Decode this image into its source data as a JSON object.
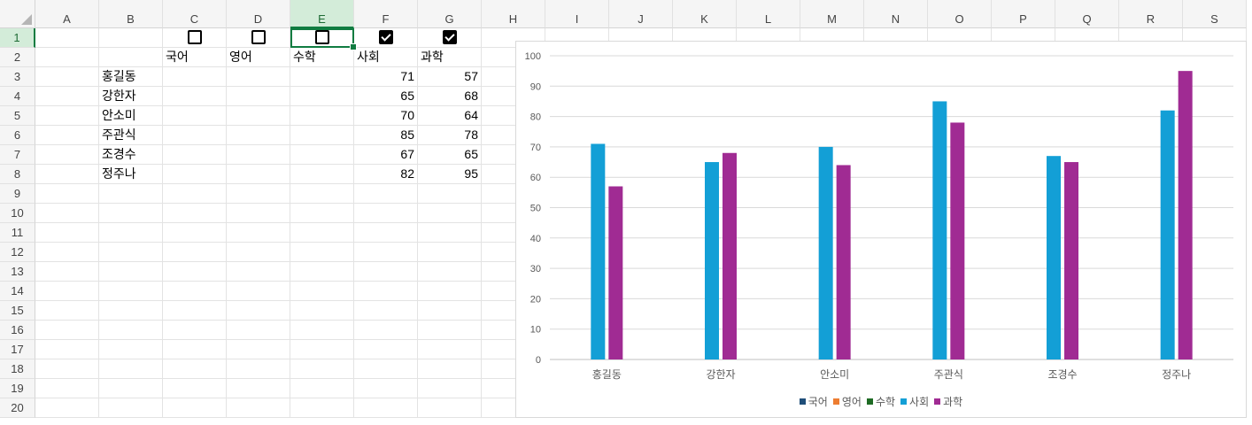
{
  "spreadsheet": {
    "columns": [
      "A",
      "B",
      "C",
      "D",
      "E",
      "F",
      "G",
      "H",
      "I",
      "J",
      "K",
      "L",
      "M",
      "N",
      "O",
      "P",
      "Q",
      "R",
      "S"
    ],
    "rows": [
      "1",
      "2",
      "3",
      "4",
      "5",
      "6",
      "7",
      "8",
      "9",
      "10",
      "11",
      "12",
      "13",
      "14",
      "15",
      "16",
      "17",
      "18",
      "19",
      "20"
    ],
    "selected_column": "E",
    "selected_row": "1",
    "checkboxes": [
      {
        "col": "C",
        "checked": false
      },
      {
        "col": "D",
        "checked": false
      },
      {
        "col": "E",
        "checked": false
      },
      {
        "col": "F",
        "checked": true
      },
      {
        "col": "G",
        "checked": true
      }
    ],
    "headers": [
      "국어",
      "영어",
      "수학",
      "사회",
      "과학"
    ],
    "students": [
      {
        "name": "홍길동",
        "social": "71",
        "science": "57"
      },
      {
        "name": "강한자",
        "social": "65",
        "science": "68"
      },
      {
        "name": "안소미",
        "social": "70",
        "science": "64"
      },
      {
        "name": "주관식",
        "social": "85",
        "science": "78"
      },
      {
        "name": "조경수",
        "social": "67",
        "science": "65"
      },
      {
        "name": "정주나",
        "social": "82",
        "science": "95"
      }
    ]
  },
  "chart_data": {
    "type": "bar",
    "categories": [
      "홍길동",
      "강한자",
      "안소미",
      "주관식",
      "조경수",
      "정주나"
    ],
    "series": [
      {
        "name": "국어",
        "values": [
          null,
          null,
          null,
          null,
          null,
          null
        ],
        "color": "#1f4e79"
      },
      {
        "name": "영어",
        "values": [
          null,
          null,
          null,
          null,
          null,
          null
        ],
        "color": "#ed7d31"
      },
      {
        "name": "수학",
        "values": [
          null,
          null,
          null,
          null,
          null,
          null
        ],
        "color": "#1e6b24"
      },
      {
        "name": "사회",
        "values": [
          71,
          65,
          70,
          85,
          67,
          82
        ],
        "color": "#139fd6"
      },
      {
        "name": "과학",
        "values": [
          57,
          68,
          64,
          78,
          65,
          95
        ],
        "color": "#a02b93"
      }
    ],
    "yticks": [
      "0",
      "10",
      "20",
      "30",
      "40",
      "50",
      "60",
      "70",
      "80",
      "90",
      "100"
    ],
    "ylim": [
      0,
      100
    ],
    "grid": true,
    "legend_position": "bottom"
  }
}
